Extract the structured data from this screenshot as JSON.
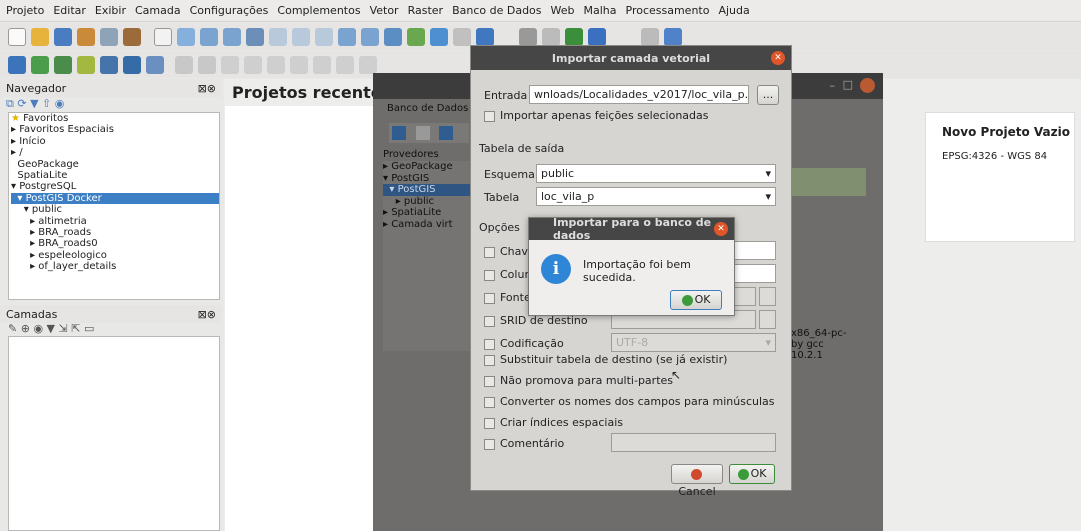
{
  "menubar": [
    "Projeto",
    "Editar",
    "Exibir",
    "Camada",
    "Configurações",
    "Complementos",
    "Vetor",
    "Raster",
    "Banco de Dados",
    "Web",
    "Malha",
    "Processamento",
    "Ajuda"
  ],
  "navigator": {
    "title": "Navegador",
    "items": [
      "Favoritos",
      "Favoritos Espaciais",
      "Início",
      "/",
      "GeoPackage",
      "SpatiaLite",
      "PostgreSQL",
      "PostGIS Docker",
      "public",
      "altimetria",
      "BRA_roads",
      "BRA_roads0",
      "espeleologico",
      "of_layer_details"
    ]
  },
  "layers_panel": {
    "title": "Camadas"
  },
  "main": {
    "recent_title": "Projetos recentes",
    "new_project_title": "Novo Projeto Vazio",
    "new_project_crs": "EPSG:4326 - WGS 84",
    "version_text": [
      "x86_64-pc-",
      "by gcc",
      "10.2.1"
    ]
  },
  "db_manager": {
    "tab": "Banco de Dados",
    "providers_label": "Provedores",
    "providers": [
      "GeoPackage",
      "PostGIS",
      "PostGIS",
      "public",
      "SpatiaLite",
      "Camada virt"
    ]
  },
  "import_dialog": {
    "title": "Importar camada vetorial",
    "input_label": "Entrada",
    "input_value": "wnloads/Localidades_v2017/loc_vila_p.shp",
    "browse_button": "...",
    "only_selected": "Importar apenas feições selecionadas",
    "output_section": "Tabela de saída",
    "schema_label": "Esquema",
    "schema_value": "public",
    "table_label": "Tabela",
    "table_value": "loc_vila_p",
    "options_section": "Opções",
    "opt_key": "Chave",
    "opt_column": "Colun",
    "opt_source": "Fonte",
    "opt_srid": "SRID de destino",
    "opt_encoding": "Codificação",
    "encoding_value": "UTF-8",
    "opt_replace": "Substituir tabela de destino (se já existir)",
    "opt_no_multi": "Não promova para multi-partes",
    "opt_lowercase": "Converter os nomes dos campos para minúsculas",
    "opt_index": "Criar índices espaciais",
    "opt_comment": "Comentário",
    "cancel_button": "Cancel",
    "ok_button": "OK"
  },
  "message_box": {
    "title": "Importar para o banco de dados",
    "message": "Importação foi bem sucedida.",
    "ok_button": "OK"
  }
}
